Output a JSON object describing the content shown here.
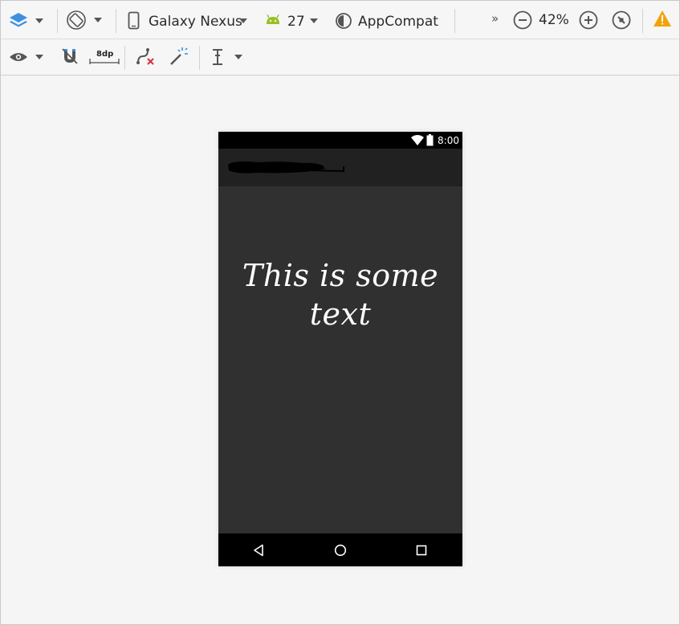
{
  "toolbar_top": {
    "device_label": "Galaxy Nexus",
    "api_level": "27",
    "theme_label": "AppCompat",
    "overflow_glyph": "»",
    "zoom_level": "42%"
  },
  "toolbar_second": {
    "margin_label": "8dp"
  },
  "preview": {
    "status_time": "8:00",
    "content_text": "This is some text"
  },
  "colors": {
    "android_green": "#97c024",
    "warning_orange": "#f0a30a",
    "layers_blue": "#3d8fe0",
    "screen_bg": "#303030",
    "appbar_bg": "#212121"
  },
  "icons": [
    "layers-icon",
    "rotate-icon",
    "device-icon",
    "android-icon",
    "theme-icon",
    "zoom-out-icon",
    "zoom-in-icon",
    "zoom-reset-icon",
    "warning-icon",
    "eye-icon",
    "magnet-icon",
    "margin-icon",
    "clear-constraints-icon",
    "infer-constraints-icon",
    "guidelines-icon",
    "wifi-icon",
    "battery-icon",
    "nav-back-icon",
    "nav-home-icon",
    "nav-recents-icon"
  ]
}
